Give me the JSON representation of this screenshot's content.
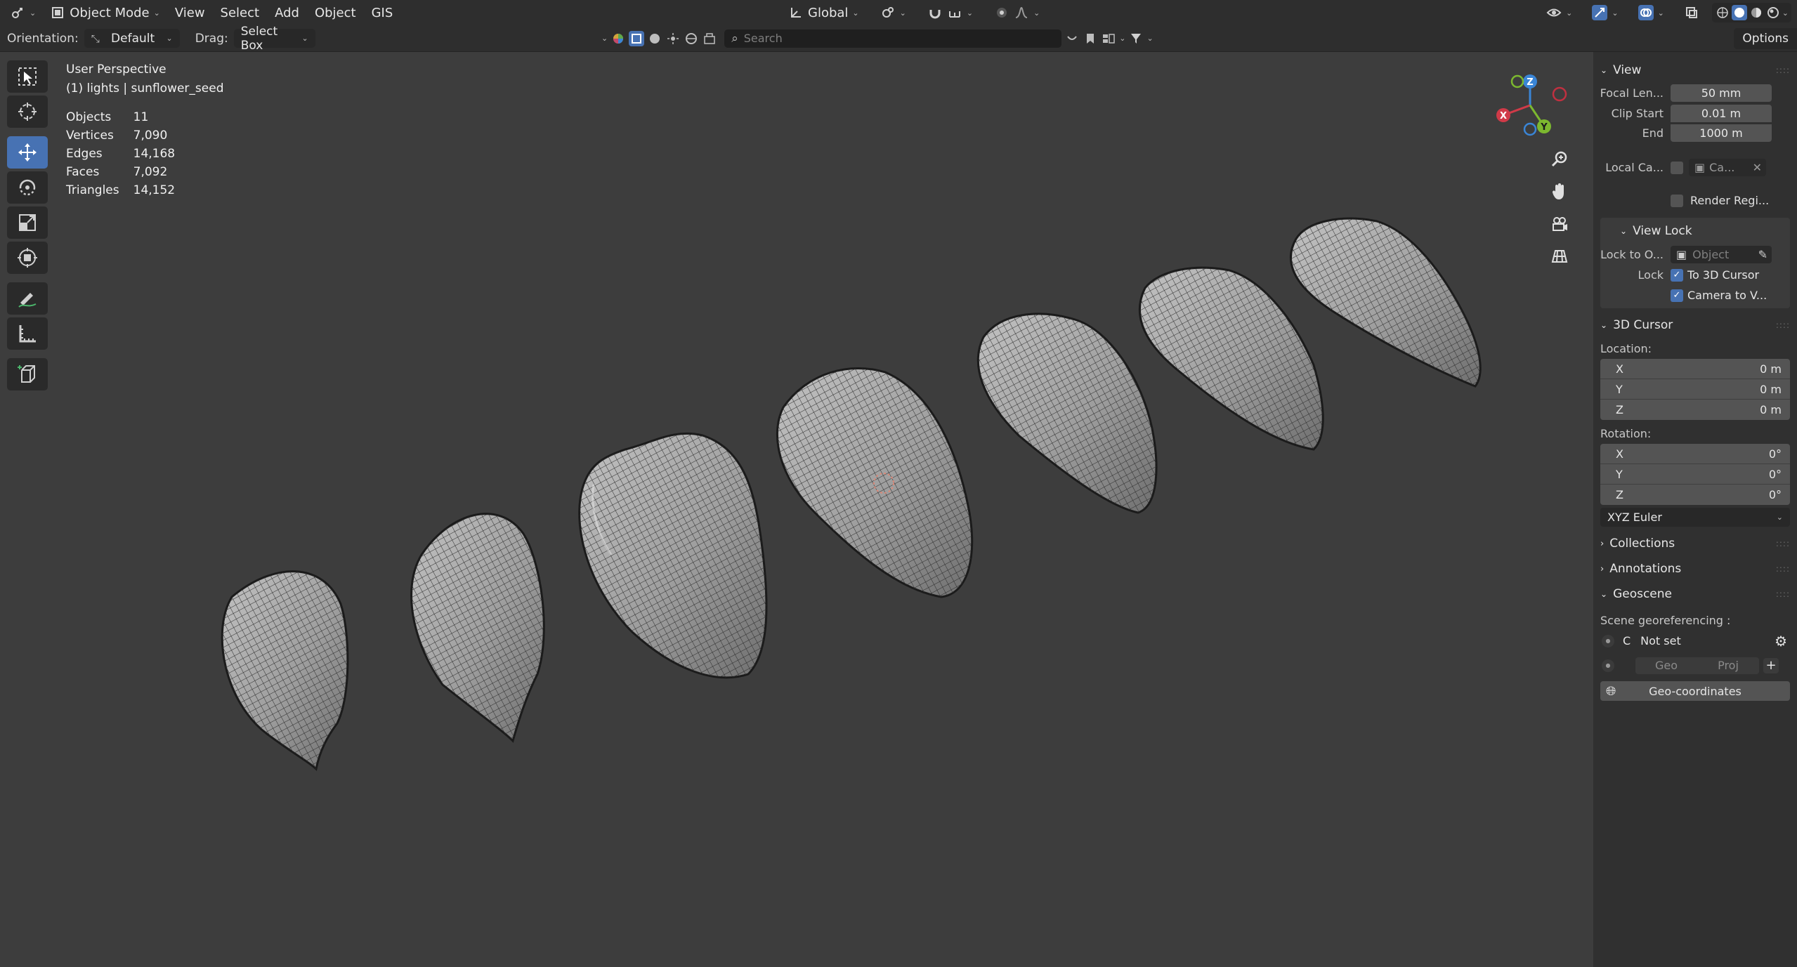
{
  "header": {
    "mode": "Object Mode",
    "menus": [
      "View",
      "Select",
      "Add",
      "Object",
      "GIS"
    ],
    "transform_orientation": "Global"
  },
  "tool_header": {
    "orientation_label": "Orientation:",
    "orientation_value": "Default",
    "drag_label": "Drag:",
    "drag_value": "Select Box",
    "search_placeholder": "Search",
    "options_label": "Options"
  },
  "viewport": {
    "perspective": "User Perspective",
    "collection": "(1) lights | sunflower_seed",
    "stats": [
      {
        "label": "Objects",
        "value": "11"
      },
      {
        "label": "Vertices",
        "value": "7,090"
      },
      {
        "label": "Edges",
        "value": "14,168"
      },
      {
        "label": "Faces",
        "value": "7,092"
      },
      {
        "label": "Triangles",
        "value": "14,152"
      }
    ],
    "gizmo": {
      "x": "X",
      "y": "Y",
      "z": "Z"
    }
  },
  "sidebar": {
    "view_title": "View",
    "focal_length_label": "Focal Len...",
    "focal_length_value": "50 mm",
    "clip_start_label": "Clip Start",
    "clip_start_value": "0.01 m",
    "clip_end_label": "End",
    "clip_end_value": "1000 m",
    "local_camera_label": "Local Ca...",
    "local_camera_value": "Ca...",
    "render_region_label": "Render Regi...",
    "view_lock_title": "View Lock",
    "lock_object_label": "Lock to O...",
    "lock_object_placeholder": "Object",
    "lock_label": "Lock",
    "lock_cursor_label": "To 3D Cursor",
    "lock_camera_label": "Camera to V...",
    "cursor_title": "3D Cursor",
    "location_label": "Location:",
    "location": [
      {
        "axis": "X",
        "value": "0 m"
      },
      {
        "axis": "Y",
        "value": "0 m"
      },
      {
        "axis": "Z",
        "value": "0 m"
      }
    ],
    "rotation_label": "Rotation:",
    "rotation": [
      {
        "axis": "X",
        "value": "0°"
      },
      {
        "axis": "Y",
        "value": "0°"
      },
      {
        "axis": "Z",
        "value": "0°"
      }
    ],
    "rotation_mode": "XYZ Euler",
    "collections_title": "Collections",
    "annotations_title": "Annotations",
    "geoscene_title": "Geoscene",
    "scene_georef_label": "Scene georeferencing :",
    "crs_prefix": "C",
    "crs_value": "Not set",
    "geo_tab": "Geo",
    "proj_tab": "Proj",
    "geo_coords_button": "Geo-coordinates"
  },
  "colors": {
    "accent": "#4772b3",
    "viewport_bg": "#3d3d3d",
    "gizmo_x": "#d03a48",
    "gizmo_y": "#7cb82f",
    "gizmo_z": "#3a85d6"
  }
}
